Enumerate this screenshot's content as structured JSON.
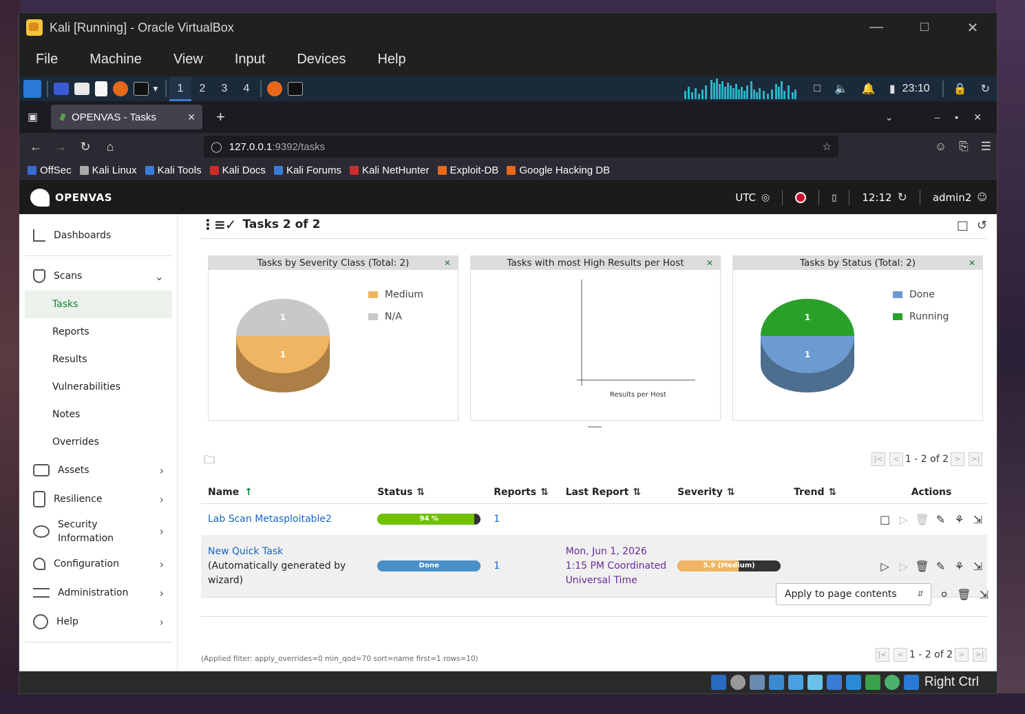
{
  "vbox": {
    "title": "Kali [Running] - Oracle VirtualBox",
    "menu": [
      "File",
      "Machine",
      "View",
      "Input",
      "Devices",
      "Help"
    ],
    "status_right": "Right Ctrl"
  },
  "kali_panel": {
    "workspaces": [
      "1",
      "2",
      "3",
      "4"
    ],
    "active_workspace": "1",
    "clock": "23:10"
  },
  "browser": {
    "tab_title": "OPENVAS - Tasks",
    "url_host": "127.0.0.1",
    "url_rest": ":9392/tasks",
    "bookmarks": [
      {
        "label": "OffSec",
        "color": "#3a6bd0"
      },
      {
        "label": "Kali Linux",
        "color": "#aaaaaa"
      },
      {
        "label": "Kali Tools",
        "color": "#3a7bd5"
      },
      {
        "label": "Kali Docs",
        "color": "#d02b2b"
      },
      {
        "label": "Kali Forums",
        "color": "#3a7bd5"
      },
      {
        "label": "Kali NetHunter",
        "color": "#d02b2b"
      },
      {
        "label": "Exploit-DB",
        "color": "#e8681a"
      },
      {
        "label": "Google Hacking DB",
        "color": "#e8681a"
      }
    ]
  },
  "openvas": {
    "logo": "OPENVAS",
    "timezone": "UTC",
    "time": "12:12",
    "user": "admin2",
    "sidebar": {
      "dashboards": "Dashboards",
      "scans": "Scans",
      "scans_sub": [
        "Tasks",
        "Reports",
        "Results",
        "Vulnerabilities",
        "Notes",
        "Overrides"
      ],
      "active_sub": "Tasks",
      "assets": "Assets",
      "resilience": "Resilience",
      "security_info": "Security Information",
      "configuration": "Configuration",
      "administration": "Administration",
      "help": "Help"
    },
    "page_title": "Tasks 2 of 2",
    "charts": {
      "severity": {
        "title": "Tasks by Severity Class (Total: 2)",
        "legend": [
          "Medium",
          "N/A"
        ]
      },
      "high_results": {
        "title": "Tasks with most High Results per Host",
        "xlabel": "Results per Host"
      },
      "status": {
        "title": "Tasks by Status (Total: 2)",
        "legend": [
          "Done",
          "Running"
        ]
      }
    },
    "pager": "1 - 2 of 2",
    "columns": {
      "name": "Name",
      "status": "Status",
      "reports": "Reports",
      "last_report": "Last Report",
      "severity": "Severity",
      "trend": "Trend",
      "actions": "Actions"
    },
    "tasks": [
      {
        "name": "Lab Scan Metasploitable2",
        "comment": "",
        "status_label": "94 %",
        "progress": 0.94,
        "reports": "1",
        "last_report_1": "",
        "last_report_2": "",
        "last_report_3": "",
        "severity_label": ""
      },
      {
        "name": "New Quick Task",
        "comment": "(Automatically generated by wizard)",
        "status_label": "Done",
        "progress": 1,
        "reports": "1",
        "last_report_1": "Mon, Jun 1, 2026",
        "last_report_2": "1:15 PM Coordinated",
        "last_report_3": "Universal Time",
        "severity_label": "5.9 (Medium)",
        "severity_value": 5.9
      }
    ],
    "bulk_select": "Apply to page contents",
    "filter_text": "(Applied filter: apply_overrides=0 min_qod=70 sort=name first=1 rows=10)",
    "colors": {
      "green": "#11823b",
      "progress_green": "#70c000",
      "done_blue": "#4a90c8",
      "medium_orange": "#f0b562",
      "na_gray": "#c8c8c8",
      "running_green": "#2aa02a",
      "done_light_blue": "#6c9bd2"
    }
  }
}
